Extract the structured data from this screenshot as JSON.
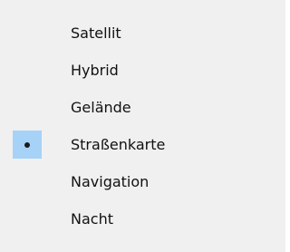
{
  "menu": {
    "items": [
      {
        "label": "Satellit",
        "checked": false
      },
      {
        "label": "Hybrid",
        "checked": false
      },
      {
        "label": "Gelände",
        "checked": false
      },
      {
        "label": "Straßenkarte",
        "checked": true
      },
      {
        "label": "Navigation",
        "checked": false
      },
      {
        "label": "Nacht",
        "checked": false
      }
    ]
  },
  "colors": {
    "menu_background": "#f0f0f0",
    "checked_highlight": "#a7d2f7",
    "text": "#111111"
  },
  "icons": {
    "checked_marker": "radio-bullet-icon"
  }
}
